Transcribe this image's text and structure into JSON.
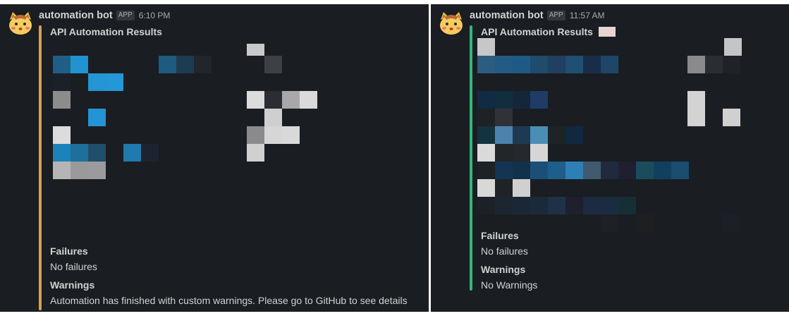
{
  "messages": [
    {
      "bot_name": "automation bot",
      "app_badge": "APP",
      "timestamp": "6:10 PM",
      "attachment_title": "API Automation Results",
      "accent_color": "#d8a24b",
      "failures_heading": "Failures",
      "failures_text": "No failures",
      "warnings_heading": "Warnings",
      "warnings_text": "Automation has finished with custom warnings. Please go to GitHub to see details"
    },
    {
      "bot_name": "automation bot",
      "app_badge": "APP",
      "timestamp": "11:57 AM",
      "attachment_title": "API Automation Results",
      "accent_color": "#2fb67c",
      "failures_heading": "Failures",
      "failures_text": "No failures",
      "warnings_heading": "Warnings",
      "warnings_text": "No Warnings"
    }
  ]
}
